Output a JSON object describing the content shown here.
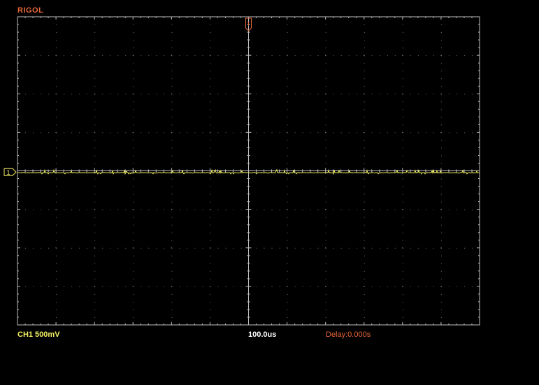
{
  "brand": "RIGOL",
  "trigger_marker": "T",
  "channel_marker": "1",
  "status": {
    "channel_scale": "CH1 500mV",
    "timebase": "100.0us",
    "delay": "Delay:0.000s"
  },
  "colors": {
    "background": "#000000",
    "grid": "#BFBFBF",
    "trace": "#F2EF62",
    "brand": "#E8683A",
    "channel_text": "#F2EF62",
    "timebase_text": "#FFFFFF",
    "delay_text": "#E8683A",
    "trigger_marker": "#E8683A"
  },
  "grid": {
    "h_divisions": 12,
    "v_divisions": 8,
    "minor_per_div": 5
  },
  "trace": {
    "level_div": -0.05,
    "noise": "low"
  }
}
